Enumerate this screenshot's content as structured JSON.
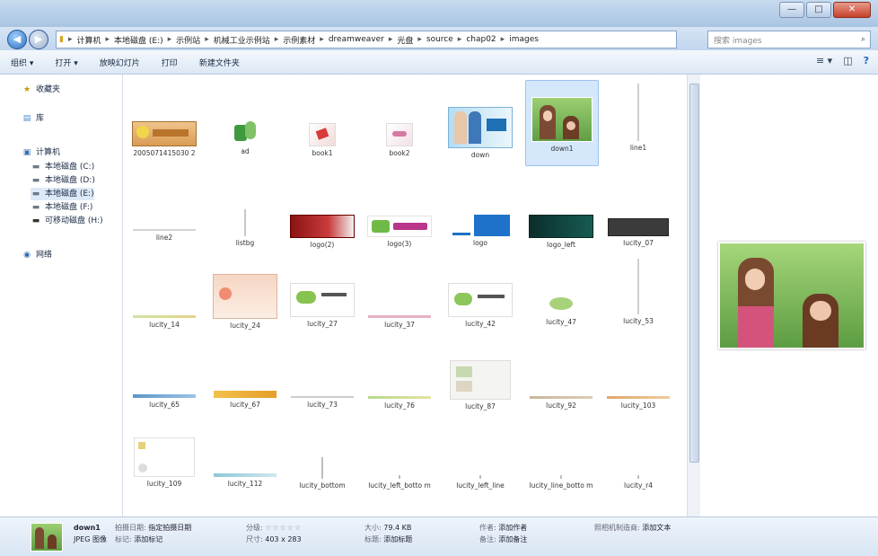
{
  "window": {
    "min_label": "—",
    "max_label": "□",
    "close_label": "✕"
  },
  "nav": {
    "back_icon": "◀",
    "forward_icon": "▶",
    "path": [
      "计算机",
      "本地磁盘 (E:)",
      "示例站",
      "机械工业示例站",
      "示例素材",
      "dreamweaver",
      "光盘",
      "source",
      "chap02",
      "images"
    ],
    "search_placeholder": "搜索 images"
  },
  "toolbar": {
    "organize": "组织 ▾",
    "open": "打开 ▾",
    "slideshow": "放映幻灯片",
    "print": "打印",
    "new_folder": "新建文件夹",
    "view_icon": "≡ ▾",
    "pane_icon": "◫",
    "help_icon": "?"
  },
  "sidebar": {
    "favorites": "收藏夹",
    "libraries": "库",
    "computer": "计算机",
    "drives": [
      "本地磁盘 (C:)",
      "本地磁盘 (D:)",
      "本地磁盘 (E:)",
      "本地磁盘 (F:)",
      "可移动磁盘 (H:)"
    ],
    "network": "网络"
  },
  "files": [
    {
      "name": "2005071415030 2"
    },
    {
      "name": "ad"
    },
    {
      "name": "book1"
    },
    {
      "name": "book2"
    },
    {
      "name": "down"
    },
    {
      "name": "down1"
    },
    {
      "name": "line1"
    },
    {
      "name": "line2"
    },
    {
      "name": "listbg"
    },
    {
      "name": "logo(2)"
    },
    {
      "name": "logo(3)"
    },
    {
      "name": "logo"
    },
    {
      "name": "logo_left"
    },
    {
      "name": "lucity_07"
    },
    {
      "name": "lucity_14"
    },
    {
      "name": "lucity_24"
    },
    {
      "name": "lucity_27"
    },
    {
      "name": "lucity_37"
    },
    {
      "name": "lucity_42"
    },
    {
      "name": "lucity_47"
    },
    {
      "name": "lucity_53"
    },
    {
      "name": "lucity_65"
    },
    {
      "name": "lucity_67"
    },
    {
      "name": "lucity_73"
    },
    {
      "name": "lucity_76"
    },
    {
      "name": "lucity_87"
    },
    {
      "name": "lucity_92"
    },
    {
      "name": "lucity_103"
    },
    {
      "name": "lucity_109"
    },
    {
      "name": "lucity_112"
    },
    {
      "name": "lucity_bottom"
    },
    {
      "name": "lucity_left_botto m"
    },
    {
      "name": "lucity_left_line"
    },
    {
      "name": "lucity_line_botto m"
    },
    {
      "name": "lucity_r4"
    }
  ],
  "selected_file": "down1",
  "status": {
    "name": "down1",
    "type": "JPEG 图像",
    "taken_label": "拍摄日期:",
    "taken_value": "指定拍摄日期",
    "tags_label": "标记:",
    "tags_value": "添加标记",
    "rating_label": "分级:",
    "rating_value": "☆☆☆☆☆",
    "dims_label": "尺寸:",
    "dims_value": "403 x 283",
    "size_label": "大小:",
    "size_value": "79.4 KB",
    "title_label": "标题:",
    "title_value": "添加标题",
    "authors_label": "作者:",
    "authors_value": "添加作者",
    "comments_label": "备注:",
    "comments_value": "添加备注",
    "program_label": "照相机制造商:",
    "program_value": "添加文本"
  }
}
